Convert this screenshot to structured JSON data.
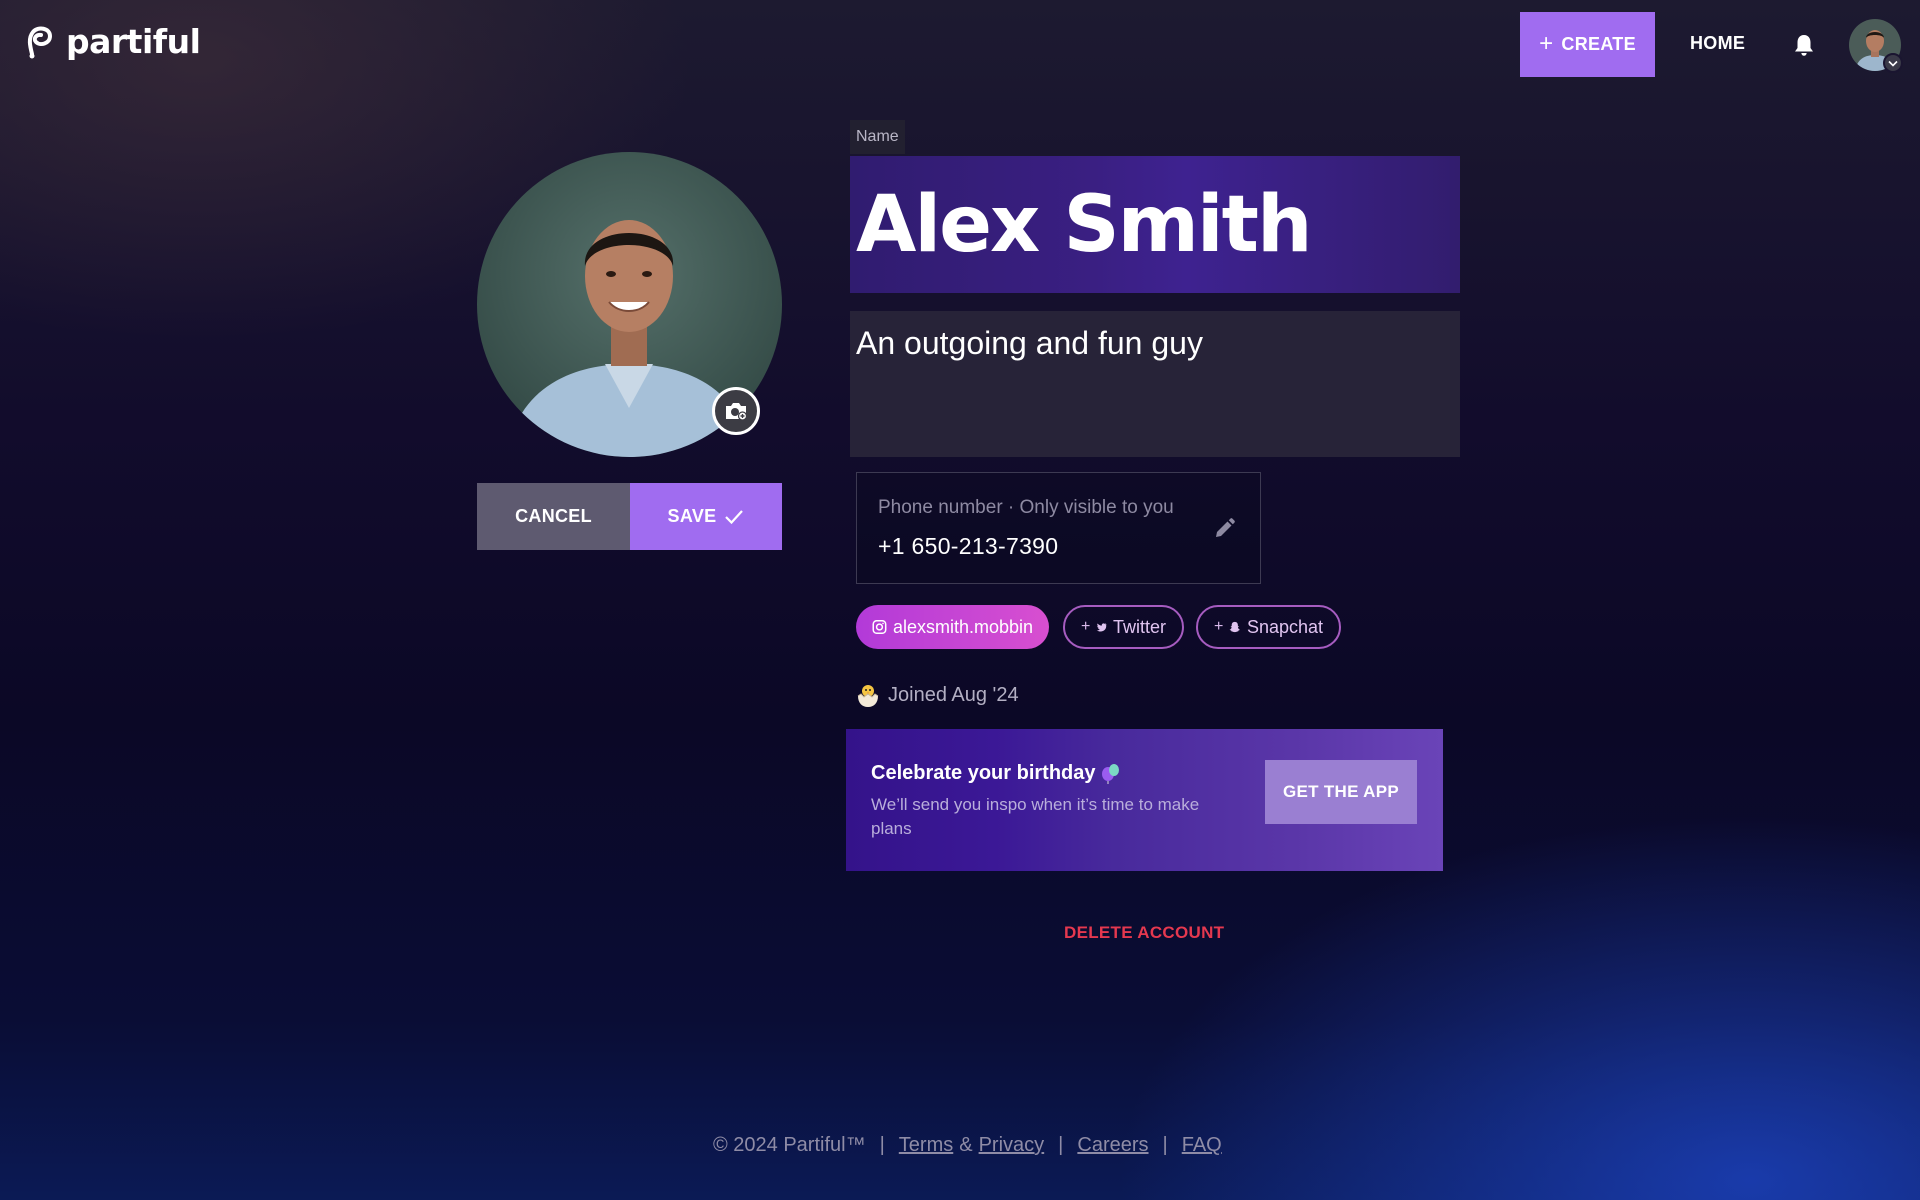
{
  "nav": {
    "brand": "partiful",
    "create_label": "CREATE",
    "create_icon": "+",
    "home_label": "HOME"
  },
  "profile": {
    "name_label": "Name",
    "name": "Alex Smith",
    "bio": "An outgoing and fun guy",
    "phone_placeholder": "Phone number · Only visible to you",
    "phone": "+1 650-213-7390",
    "cancel_label": "CANCEL",
    "save_label": "SAVE"
  },
  "socials": {
    "instagram": "alexsmith.mobbin",
    "twitter": "Twitter",
    "snapchat": "Snapchat",
    "add_icon": "+"
  },
  "joined": "Joined Aug '24",
  "promo": {
    "title": "Celebrate your birthday",
    "subtitle": "We’ll send you inspo when it’s time to make plans",
    "button": "GET THE APP"
  },
  "delete_label": "DELETE ACCOUNT",
  "footer": {
    "copyright": "© 2024 Partiful™",
    "terms": "Terms",
    "amp": "&",
    "privacy": "Privacy",
    "careers": "Careers",
    "faq": "FAQ",
    "sep": "|"
  },
  "colors": {
    "accent": "#a06cf0",
    "danger": "#e5384f",
    "instagram_chip": "#c646d4"
  }
}
